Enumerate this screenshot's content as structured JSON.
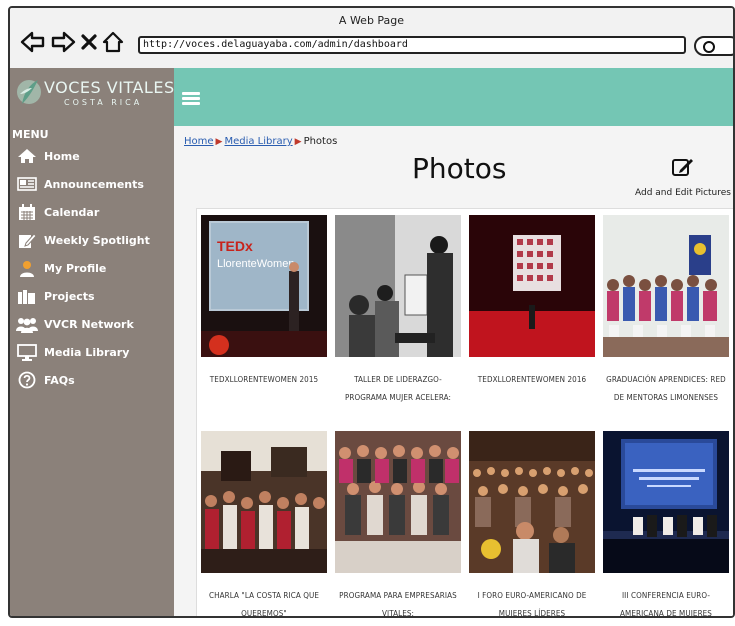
{
  "browser": {
    "window_title": "A Web Page",
    "url": "http://voces.delaguayaba.com/admin/dashboard"
  },
  "brand": {
    "name": "VOCES VITALES",
    "subtitle": "COSTA RICA",
    "header_color": "#74c6b4",
    "sidebar_color": "#8b817a"
  },
  "sidebar": {
    "heading": "MENU",
    "items": [
      {
        "label": "Home",
        "icon": "home-icon"
      },
      {
        "label": "Announcements",
        "icon": "newspaper-icon"
      },
      {
        "label": "Calendar",
        "icon": "calendar-icon"
      },
      {
        "label": "Weekly Spotlight",
        "icon": "edit-icon"
      },
      {
        "label": "My Profile",
        "icon": "user-icon"
      },
      {
        "label": "Projects",
        "icon": "folders-icon"
      },
      {
        "label": "VVCR Network",
        "icon": "group-icon"
      },
      {
        "label": "Media Library",
        "icon": "monitor-icon"
      },
      {
        "label": "FAQs",
        "icon": "question-icon"
      }
    ]
  },
  "breadcrumb": {
    "home": "Home",
    "media_library": "Media Library",
    "current": "Photos"
  },
  "main": {
    "title": "Photos",
    "add_edit_label": "Add and Edit Pictures"
  },
  "albums": [
    {
      "caption": "TEDXLLORENTEWOMEN 2015"
    },
    {
      "caption": "TALLER DE LIDERAZGO-PROGRAMA MUJER ACELERA:"
    },
    {
      "caption": "TEDXLLORENTEWOMEN 2016"
    },
    {
      "caption": "GRADUACIÓN APRENDICES: RED DE MENTORAS LIMONENSES"
    },
    {
      "caption": "CHARLA \"LA COSTA RICA QUE QUEREMOS\""
    },
    {
      "caption": "PROGRAMA PARA EMPRESARIAS VITALES:"
    },
    {
      "caption": "I FORO EURO-AMERICANO DE MUJERES LÍDERES"
    },
    {
      "caption": "III CONFERENCIA EURO-AMERICANA DE MUJERES LÍDERES :"
    }
  ],
  "photo_texts": {
    "ted_logo": "TEDx",
    "ted_name": "LlorenteWomen"
  }
}
